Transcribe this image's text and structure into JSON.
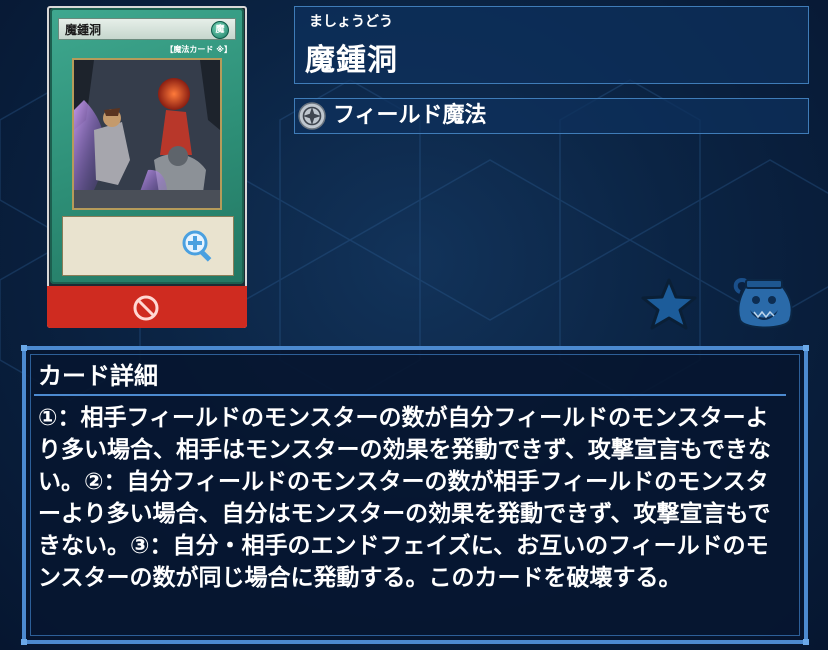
{
  "card": {
    "name": "魔鍾洞",
    "attribute_glyph": "魔",
    "type_line": "【魔法カード",
    "type_symbol": "※"
  },
  "card_info": {
    "ruby": "ましょうどう",
    "name": "魔鍾洞",
    "spell_type": "フィールド魔法"
  },
  "details": {
    "title": "カード詳細",
    "text": "①：相手フィールドのモンスターの数が自分フィールドのモンスターより多い場合、相手はモンスターの効果を発動できず、攻撃宣言もできない。②：自分フィールドのモンスターの数が相手フィールドのモンスターより多い場合、自分はモンスターの効果を発動できず、攻撃宣言もできない。③：自分・相手のエンドフェイズに、お互いのフィールドのモンスターの数が同じ場合に発動する。このカードを破壊する。"
  },
  "colors": {
    "accent": "#4c8ad0",
    "ban_bar": "#cf2b20",
    "spell_card": "#2d8e76"
  },
  "icons": {
    "zoom": "magnify-plus-icon",
    "ban": "prohibited-icon",
    "spell_type": "field-spell-icon",
    "favorite": "star-icon",
    "deck": "pot-of-greed-icon"
  }
}
